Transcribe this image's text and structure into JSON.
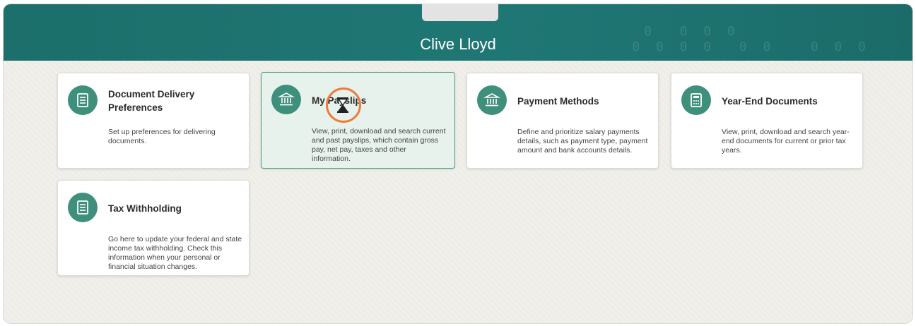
{
  "header": {
    "title": "Clive Lloyd"
  },
  "cards": [
    {
      "title": "Document Delivery Preferences",
      "description": "Set up preferences for delivering documents.",
      "icon": "document-icon"
    },
    {
      "title": "My Payslips",
      "description": "View, print, download and search current and past payslips, which contain gross pay, net pay, taxes and other information.",
      "icon": "bank-icon"
    },
    {
      "title": "Payment Methods",
      "description": "Define and prioritize salary payments details, such as payment type, payment amount and bank accounts details.",
      "icon": "bank-icon"
    },
    {
      "title": "Year-End Documents",
      "description": "View, print, download and search year-end documents for current or prior tax years.",
      "icon": "calculator-icon"
    },
    {
      "title": "Tax Withholding",
      "description": "Go here to update your federal and state income tax withholding. Check this information when your personal or financial situation changes.",
      "icon": "document-icon"
    }
  ],
  "colors": {
    "header": "#1f7774",
    "icon_bg": "#3f8f7d",
    "selected_card": "#e8f2ec",
    "cursor_ring": "#ee7a3b"
  }
}
